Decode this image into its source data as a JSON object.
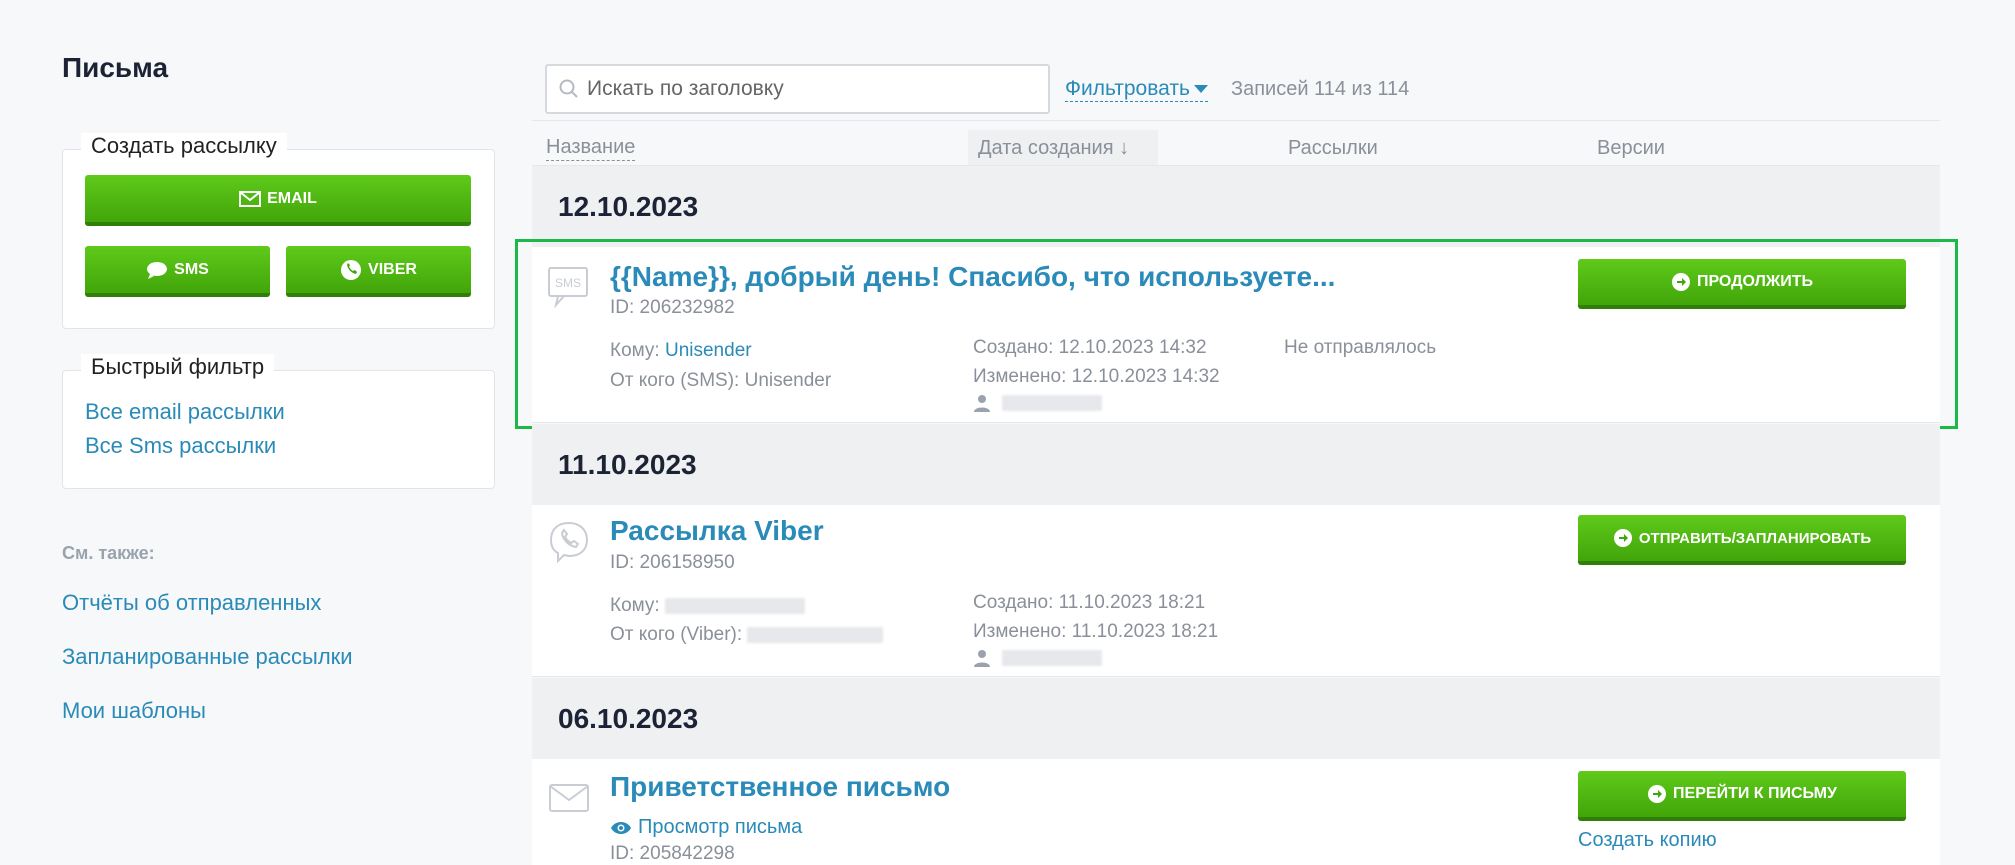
{
  "sidebar": {
    "title": "Письма",
    "create": {
      "legend": "Создать рассылку",
      "email_label": "EMAIL",
      "sms_label": "SMS",
      "viber_label": "VIBER"
    },
    "quick_filter": {
      "legend": "Быстрый фильтр",
      "items": [
        "Все email рассылки",
        "Все Sms рассылки"
      ]
    },
    "see_also": {
      "label": "См. также:",
      "links": [
        "Отчёты об отправленных",
        "Запланированные рассылки",
        "Мои шаблоны"
      ]
    }
  },
  "toolbar": {
    "search_placeholder": "Искать по заголовку",
    "filter_label": "Фильтровать",
    "records": "Записей 114 из 114"
  },
  "columns": {
    "name": "Название",
    "date": "Дата создания ↓",
    "mailings": "Рассылки",
    "versions": "Версии"
  },
  "groups": [
    {
      "date": "12.10.2023",
      "item": {
        "type_icon": "sms-icon",
        "title": "{{Name}}, добрый день! Спасибо, что используете...",
        "id": "ID: 206232982",
        "to_label": "Кому:",
        "to_value": "Unisender",
        "from": "От кого (SMS): Unisender",
        "created": "Создано: 12.10.2023 14:32",
        "modified": "Изменено: 12.10.2023 14:32",
        "status": "Не отправлялось",
        "action": "ПРОДОЛЖИТЬ"
      }
    },
    {
      "date": "11.10.2023",
      "item": {
        "type_icon": "viber-icon",
        "title": "Рассылка Viber",
        "id": "ID: 206158950",
        "to_label": "Кому:",
        "from_label": "От кого (Viber):",
        "created": "Создано: 11.10.2023 18:21",
        "modified": "Изменено: 11.10.2023 18:21",
        "action": "ОТПРАВИТЬ/ЗАПЛАНИРОВАТЬ"
      }
    },
    {
      "date": "06.10.2023",
      "item": {
        "type_icon": "envelope-icon",
        "title": "Приветственное письмо",
        "view_label": "Просмотр письма",
        "id": "ID: 205842298",
        "action": "ПЕРЕЙТИ К ПИСЬМУ",
        "copy_label": "Создать копию"
      }
    }
  ],
  "colors": {
    "accent": "#2a8ab8",
    "button_green": "#4cb112",
    "highlight": "#1cb84a"
  }
}
